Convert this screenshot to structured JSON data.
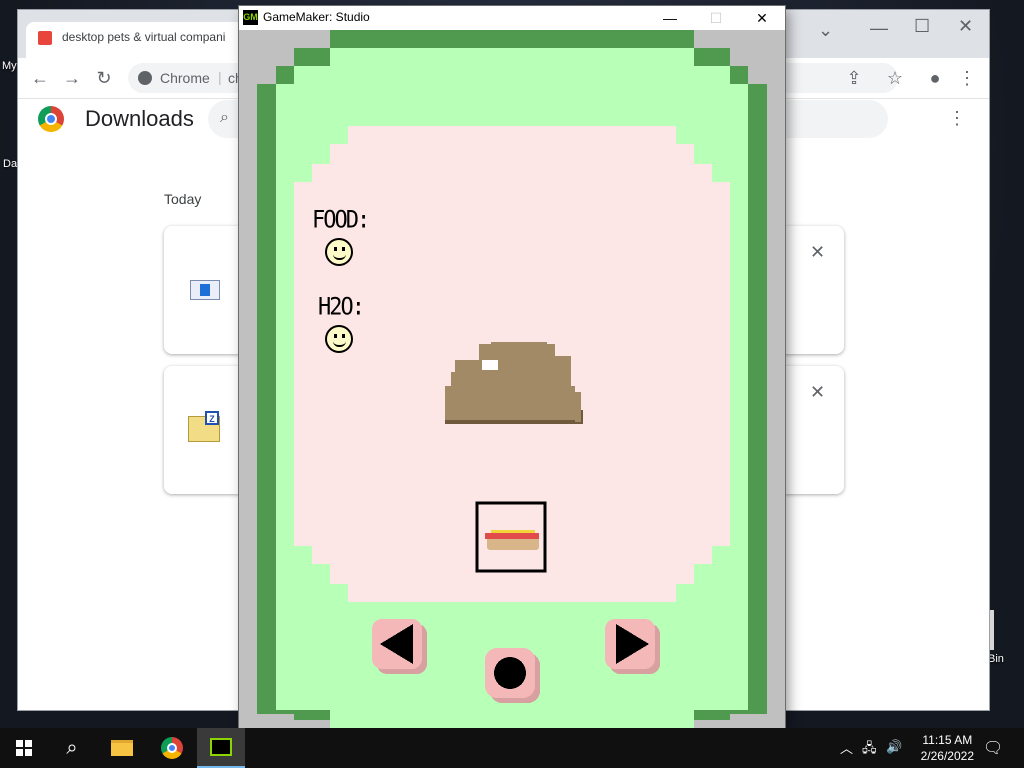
{
  "desktop": {
    "icon_left_top": "My",
    "icon_left_mid": "Da",
    "recycle_bin_label": "Bin"
  },
  "chrome": {
    "tab_title": "desktop pets & virtual compani",
    "omnibox_prefix": "Chrome",
    "omnibox_url": "ch",
    "page_title": "Downloads",
    "section_today": "Today",
    "window_controls": [
      "chevron-down",
      "minimize",
      "maximize",
      "close"
    ]
  },
  "game_window": {
    "title": "GameMaker: Studio",
    "food_label": "FOOD:",
    "h2o_label": "H2O:",
    "food_status": "happy",
    "h2o_status": "happy",
    "selected_item": "hotdog",
    "colors": {
      "frame_dark": "#4f9a4f",
      "frame_light": "#b8ffb8",
      "screen_bg": "#fde6e6",
      "pet_body": "#a38a67",
      "pet_shadow": "#6f5a3e",
      "button_bg": "#f4b8b8"
    }
  },
  "taskbar": {
    "time": "11:15 AM",
    "date": "2/26/2022",
    "pinned": [
      "start-icon",
      "search-icon",
      "file-explorer-icon",
      "chrome-icon",
      "gamemaker-icon"
    ]
  }
}
